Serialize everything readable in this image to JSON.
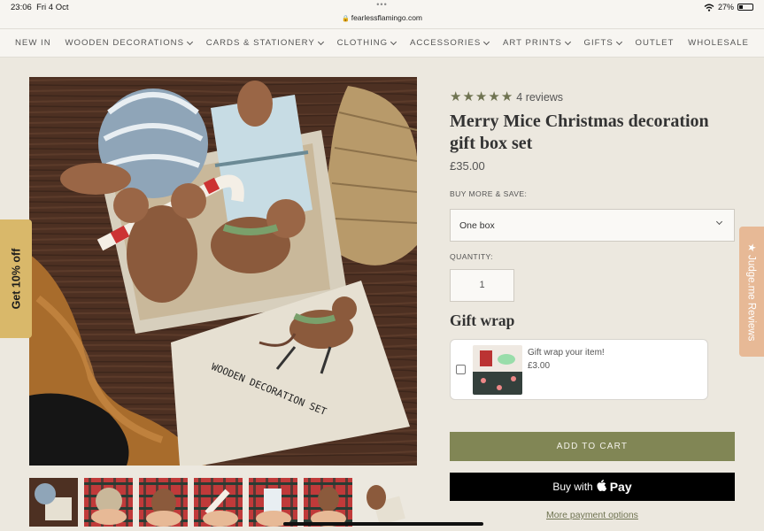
{
  "status_bar": {
    "time": "23:06",
    "date": "Fri 4 Oct",
    "url": "fearlessflamingo.com",
    "battery": "27%",
    "battery_level": 0.27
  },
  "nav": {
    "items": [
      {
        "label": "NEW IN",
        "dropdown": false
      },
      {
        "label": "WOODEN DECORATIONS",
        "dropdown": true
      },
      {
        "label": "CARDS & STATIONERY",
        "dropdown": true
      },
      {
        "label": "CLOTHING",
        "dropdown": true
      },
      {
        "label": "ACCESSORIES",
        "dropdown": true
      },
      {
        "label": "ART PRINTS",
        "dropdown": true
      },
      {
        "label": "GIFTS",
        "dropdown": true
      },
      {
        "label": "OUTLET",
        "dropdown": false
      },
      {
        "label": "WHOLESALE",
        "dropdown": false
      }
    ]
  },
  "side_tabs": {
    "discount": "Get 10% off",
    "reviews": "★ Judge.me Reviews"
  },
  "product": {
    "rating": 5,
    "reviews_label": "4 reviews",
    "title": "Merry Mice Christmas decoration gift box set",
    "price": "£35.00",
    "box_text": "WOODEN DECORATION SET",
    "buy_more_label": "BUY MORE & SAVE:",
    "option_selected": "One box",
    "quantity_label": "QUANTITY:",
    "quantity": "1",
    "gift_wrap": {
      "heading": "Gift wrap",
      "item_label": "Gift wrap your item!",
      "item_price": "£3.00"
    },
    "add_to_cart": "ADD TO CART",
    "pay_prefix": "Buy with",
    "pay_brand": "Pay",
    "more_payment": "More payment options"
  },
  "colors": {
    "accent": "#818655",
    "star": "#6f7351",
    "discount_tab": "#d9b86a",
    "reviews_tab": "#e7b996",
    "background": "#ece8df"
  }
}
